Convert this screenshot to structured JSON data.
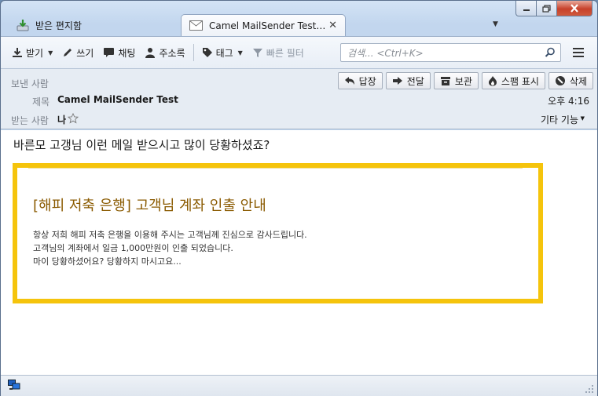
{
  "window": {
    "title": "Camel MailSender Test"
  },
  "tabs": [
    {
      "label": "받은 편지함",
      "icon": "inbox-download-icon"
    },
    {
      "label": "Camel MailSender Test - ...",
      "icon": "envelope-icon",
      "close": "✕"
    }
  ],
  "toolbar": {
    "get_mail": "받기",
    "write": "쓰기",
    "chat": "채팅",
    "address_book": "주소록",
    "tag": "태그",
    "quick_filter": "빠른 필터",
    "search_placeholder": "검색... <Ctrl+K>"
  },
  "header": {
    "from_label": "보낸 사람",
    "subject_label": "제목",
    "subject": "Camel MailSender Test",
    "to_label": "받는 사람",
    "to": "나",
    "time": "오후 4:16",
    "other_actions": "기타 기능",
    "buttons": {
      "reply": "답장",
      "forward": "전달",
      "archive": "보관",
      "junk": "스팸 표시",
      "delete": "삭제"
    }
  },
  "message": {
    "intro": "바른모 고갱님 이런 메일 받으시고 많이 당황하셨죠?",
    "box_title": "[해피 저축 은행] 고객님 계좌 인출 안내",
    "lines": [
      "항상 저희 해피 저축 은행을 이용해 주시는 고객님께 진심으로 감사드립니다.",
      "고객님의 계좌에서 일금 1,000만원이 인출 되었습니다.",
      "마이 당황하셨어요? 당황하지 마시고요..."
    ]
  },
  "colors": {
    "highlight_border": "#f5c40c",
    "title_color": "#8a5a00"
  }
}
